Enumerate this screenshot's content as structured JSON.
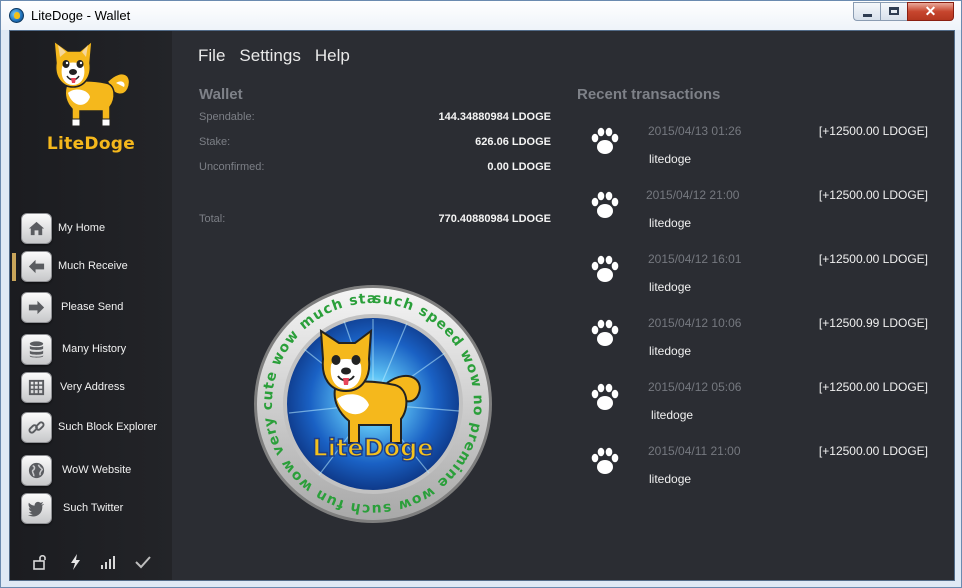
{
  "window": {
    "title": "LiteDoge - Wallet",
    "close_glyph": "✕"
  },
  "brand": {
    "name": "LiteDoge",
    "colors": {
      "accent": "#f5b81c",
      "background": "#2b2d33",
      "sidebar": "#1b1c20"
    }
  },
  "sidebar": {
    "items": [
      {
        "label": "My Home",
        "icon": "home-icon",
        "active": false
      },
      {
        "label": "Much Receive",
        "icon": "arrow-left-icon",
        "active": true
      },
      {
        "label": "Please Send",
        "icon": "arrow-right-icon",
        "active": false
      },
      {
        "label": "Many History",
        "icon": "database-icon",
        "active": false
      },
      {
        "label": "Very Address",
        "icon": "address-book-icon",
        "active": false
      },
      {
        "label": "Such Block Explorer",
        "icon": "chain-link-icon",
        "active": false
      },
      {
        "label": "WoW Website",
        "icon": "globe-icon",
        "active": false
      },
      {
        "label": "Such Twitter",
        "icon": "twitter-bird-icon",
        "active": false
      }
    ],
    "status_icons": [
      "unlocked-icon",
      "lightning-icon",
      "signal-bars-icon",
      "checkmark-icon"
    ]
  },
  "menu": {
    "file": "File",
    "settings": "Settings",
    "help": "Help"
  },
  "wallet": {
    "title": "Wallet",
    "spendable_label": "Spendable:",
    "spendable_value": "144.34880984 LDOGE",
    "stake_label": "Stake:",
    "stake_value": "626.06 LDOGE",
    "unconfirmed_label": "Unconfirmed:",
    "unconfirmed_value": "0.00 LDOGE",
    "total_label": "Total:",
    "total_value": "770.40880984 LDOGE"
  },
  "coin": {
    "ring_text": "such speed   wow   no premine   wow   such fun   wow   very cute   wow   much staking   wow",
    "center_text": "LiteDoge"
  },
  "transactions": {
    "title": "Recent transactions",
    "items": [
      {
        "date": "2015/04/13 01:26",
        "amount": "[+12500.00 LDOGE]",
        "label": "litedoge"
      },
      {
        "date": "2015/04/12 21:00",
        "amount": "[+12500.00 LDOGE]",
        "label": "litedoge"
      },
      {
        "date": "2015/04/12 16:01",
        "amount": "[+12500.00 LDOGE]",
        "label": "litedoge"
      },
      {
        "date": "2015/04/12 10:06",
        "amount": "[+12500.99 LDOGE]",
        "label": "litedoge"
      },
      {
        "date": "2015/04/12 05:06",
        "amount": "[+12500.00 LDOGE]",
        "label": "litedoge"
      },
      {
        "date": "2015/04/11 21:00",
        "amount": "[+12500.00 LDOGE]",
        "label": "litedoge"
      }
    ]
  }
}
